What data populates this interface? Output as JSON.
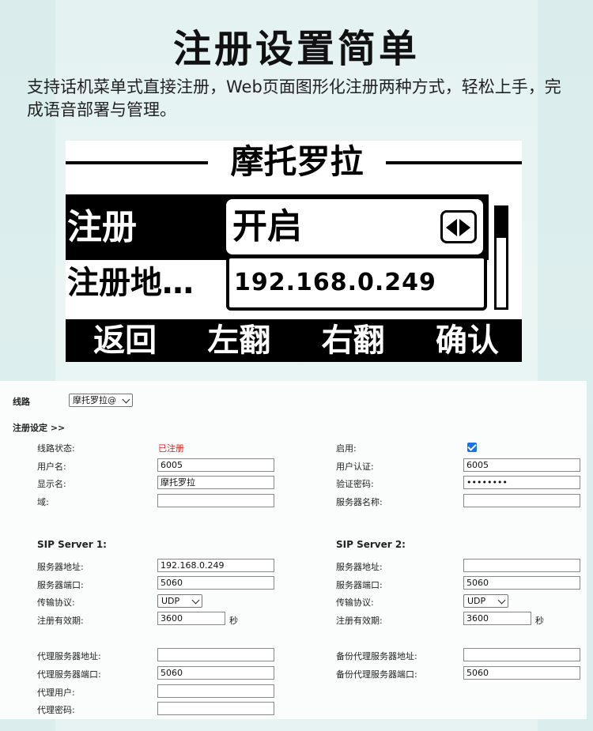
{
  "hero": {
    "title": "注册设置简单",
    "description": "支持话机菜单式直接注册，Web页面图形化注册两种方式，轻松上手，完成语音部署与管理。"
  },
  "lcd": {
    "title": "摩托罗拉",
    "row1_label": "注册",
    "row1_value": "开启",
    "row2_label": "注册地…",
    "row2_value": "192.168.0.249",
    "softkeys": [
      "返回",
      "左翻",
      "右翻",
      "确认"
    ]
  },
  "web": {
    "line_label": "线路",
    "line_select": "摩托罗拉@",
    "section_title": "注册设定 >>",
    "left": {
      "line_status_label": "线路状态:",
      "line_status_value": "已注册",
      "username_label": "用户名:",
      "username_value": "6005",
      "display_name_label": "显示名:",
      "display_name_value": "摩托罗拉",
      "domain_label": "域:",
      "domain_value": ""
    },
    "right": {
      "enable_label": "启用:",
      "enable_checked": true,
      "auth_user_label": "用户认证:",
      "auth_user_value": "6005",
      "auth_pwd_label": "验证密码:",
      "auth_pwd_value": "••••••••",
      "server_name_label": "服务器名称:",
      "server_name_value": ""
    },
    "server1": {
      "title": "SIP Server 1:",
      "addr_label": "服务器地址:",
      "addr_value": "192.168.0.249",
      "port_label": "服务器端口:",
      "port_value": "5060",
      "transport_label": "传输协议:",
      "transport_value": "UDP",
      "expire_label": "注册有效期:",
      "expire_value": "3600",
      "expire_unit": "秒"
    },
    "server2": {
      "title": "SIP Server 2:",
      "addr_label": "服务器地址:",
      "addr_value": "",
      "port_label": "服务器端口:",
      "port_value": "5060",
      "transport_label": "传输协议:",
      "transport_value": "UDP",
      "expire_label": "注册有效期:",
      "expire_value": "3600",
      "expire_unit": "秒"
    },
    "proxy": {
      "addr_label": "代理服务器地址:",
      "addr_value": "",
      "port_label": "代理服务器端口:",
      "port_value": "5060",
      "user_label": "代理用户:",
      "user_value": "",
      "pwd_label": "代理密码:",
      "pwd_value": ""
    },
    "backup_proxy": {
      "addr_label": "备份代理服务器地址:",
      "addr_value": "",
      "port_label": "备份代理服务器端口:",
      "port_value": "5060"
    }
  }
}
